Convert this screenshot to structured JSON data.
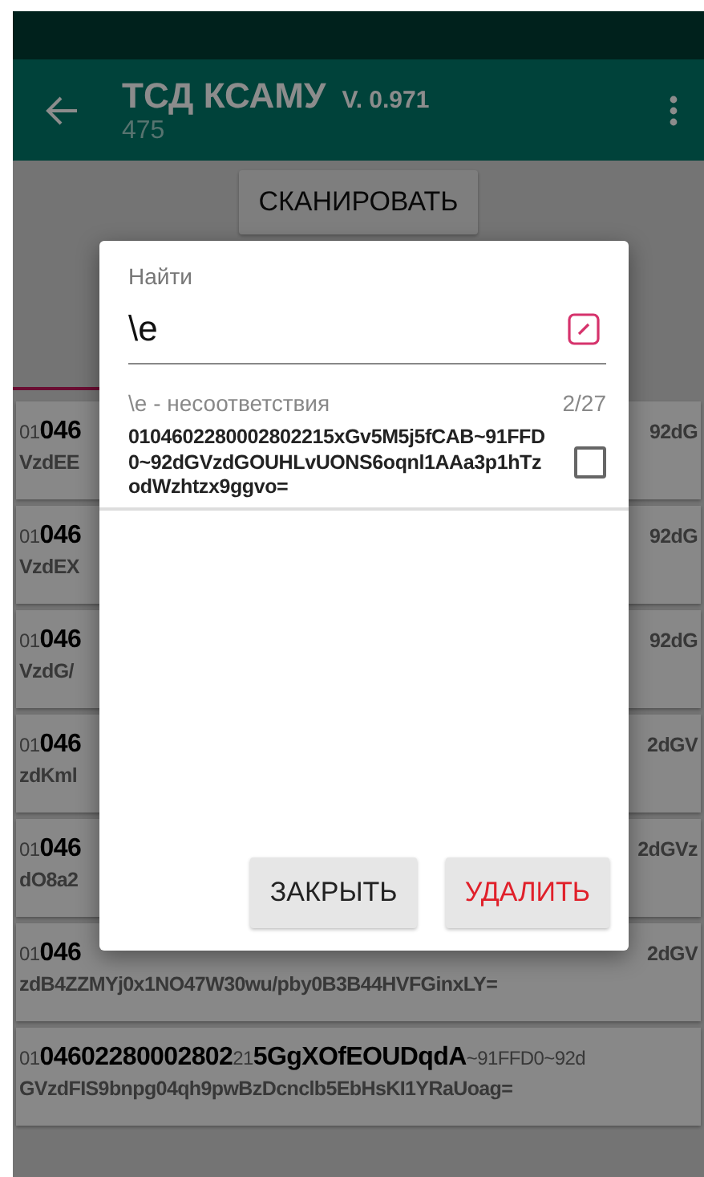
{
  "app_bar": {
    "title": "ТСД КСАМУ",
    "version": "V. 0.971",
    "subtitle": "475"
  },
  "scan_button": "СКАНИРОВАТЬ",
  "cards": [
    {
      "line1": "01**046**",
      "tail": "92dG",
      "line2": "VzdEE"
    },
    {
      "line1": "01**046**",
      "tail": "92dG",
      "line2": "VzdEX"
    },
    {
      "line1": "01**046**",
      "tail": "92dG",
      "line2": "VzdG/"
    },
    {
      "line1": "01**046**",
      "tail": "2dGV",
      "line2": "zdKml"
    },
    {
      "line1": "01**046**",
      "tail": "2dGVz",
      "line2": "dO8a2"
    },
    {
      "line1": "01**046**",
      "tail": "2dGV",
      "line2": "zdB4ZZMYj0x1NO47W30wu/pby0B3B44HVFGinxLY="
    },
    {
      "line1": "01**04602280002802**21**5GgXOfEOUDqdA**~91FFD0~92d",
      "line2": "GVzdFIS9bnpg04qh9pwBzDcnclb5EbHsKI1YRaUoag="
    }
  ],
  "dialog": {
    "label": "Найти",
    "query": "\\e",
    "filter_label": "\\e - несоответствия",
    "count": "2/27",
    "results": [
      {
        "code": "0104602280002802215xGv5M5j5fCAB~91FFD0~92dGVzdGOUHLvUONS6oqnl1AAa3p1hTzodWzhtzx9ggvo=",
        "checked": false
      }
    ],
    "buttons": [
      {
        "label": "ЗАКРЫТЬ",
        "kind": "neutral"
      },
      {
        "label": "УДАЛИТЬ",
        "kind": "danger"
      }
    ]
  }
}
